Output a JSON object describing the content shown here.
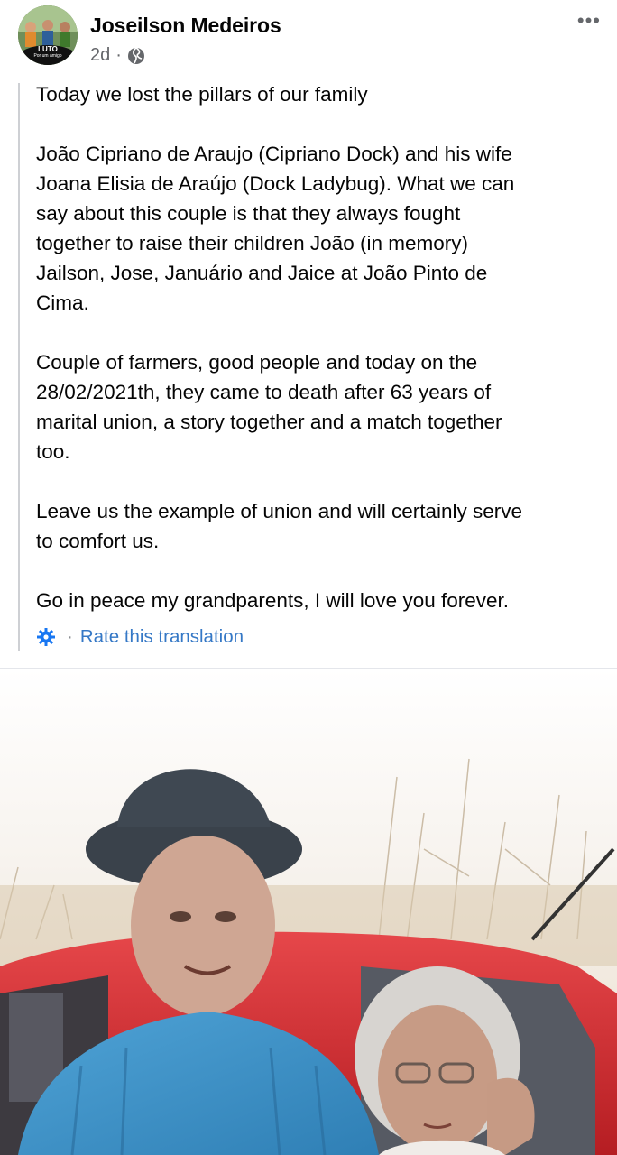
{
  "post": {
    "author": "Joseilson Medeiros",
    "time": "2d",
    "visibility_icon": "globe-icon",
    "more_icon": "more-options-icon",
    "more_glyph": "•••",
    "avatar": {
      "badge_text": "LUTO",
      "badge_subtext": "Por um amigo"
    }
  },
  "translated_text": {
    "paragraphs": [
      "Today we lost the pillars of our family",
      "João Cipriano de Araujo (Cipriano Dock) and his wife\nJoana Elisia de Araújo (Dock Ladybug). What we can\nsay about this couple is that they always fought\ntogether to raise their children João (in memory)\nJailson, Jose, Januário and Jaice at João Pinto de\nCima.",
      "Couple of farmers, good people and today on the\n28/02/2021th, they came to death after 63 years of\nmarital union, a story together and a match together\ntoo.",
      "Leave us the example of union and will certainly serve\nto comfort us.",
      "Go in peace my grandparents, I will love you forever."
    ]
  },
  "translation_bar": {
    "icon": "gear-icon",
    "separator": "·",
    "link_label": "Rate this translation"
  },
  "colors": {
    "link": "#3578c6",
    "meta": "#65676b",
    "car_red": "#c8242a"
  }
}
